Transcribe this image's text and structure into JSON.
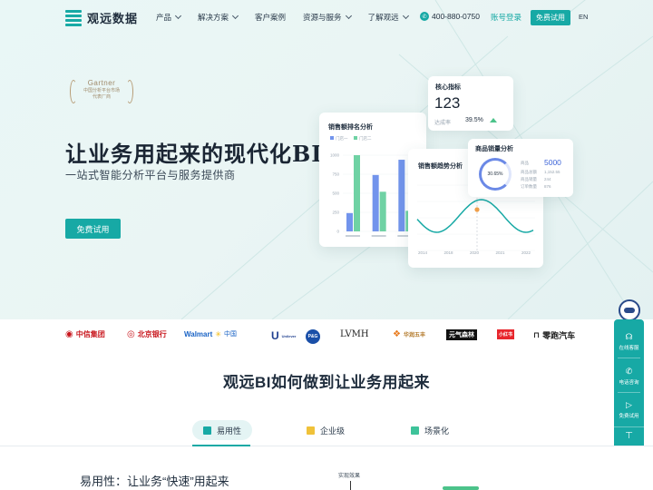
{
  "nav": {
    "brand": "观远数据",
    "menu": [
      {
        "label": "产品",
        "dropdown": true
      },
      {
        "label": "解决方案",
        "dropdown": true
      },
      {
        "label": "客户案例",
        "dropdown": false
      },
      {
        "label": "资源与服务",
        "dropdown": true
      },
      {
        "label": "了解观远",
        "dropdown": true
      }
    ],
    "phone": "400-880-0750",
    "login": "账号登录",
    "trial": "免费试用",
    "lang": "EN"
  },
  "hero": {
    "gartner_title": "Gartner",
    "gartner_line1": "中国分析平台市场",
    "gartner_line2": "代表厂商",
    "title": "让业务用起来的现代化BI",
    "subtitle": "一站式智能分析平台与服务提供商",
    "trial": "免费试用"
  },
  "cards": {
    "kpi": {
      "title": "核心指标",
      "value": "123",
      "label": "达成率",
      "percent": "39.5%"
    },
    "rank": {
      "title": "销售额排名分析",
      "legend": [
        "门店一",
        "门店二"
      ]
    },
    "trend": {
      "title": "销售额趋势分析"
    },
    "product": {
      "title": "商品销量分析",
      "ring_value": "30.65%",
      "rows": [
        {
          "label": "商品",
          "value": "5000"
        },
        {
          "label": "商品总额",
          "value": "1,152.55"
        },
        {
          "label": "商品销量",
          "value": "244"
        },
        {
          "label": "订单数量",
          "value": "876"
        }
      ]
    }
  },
  "chart_data": [
    {
      "type": "bar",
      "title": "销售额排名分析",
      "categories": [
        "",
        "",
        ""
      ],
      "series": [
        {
          "name": "门店一",
          "values": [
            240,
            740,
            940
          ]
        },
        {
          "name": "门店二",
          "values": [
            1000,
            520,
            270
          ]
        }
      ],
      "yticks": [
        "1000",
        "750",
        "500",
        "250",
        "0"
      ],
      "ylim": [
        0,
        1000
      ],
      "colors": [
        "#7294ec",
        "#6fd2a4"
      ]
    },
    {
      "type": "line",
      "title": "销售额趋势分析",
      "x": [
        "2014",
        "2018",
        "2020",
        "2021",
        "2022"
      ],
      "colors": [
        "#17a9a5",
        "#f0a04b"
      ]
    }
  ],
  "logos": [
    "中信集团",
    "北京银行",
    "Walmart",
    "中国",
    "Unilever",
    "P&G",
    "LVMH",
    "华润五丰",
    "元气森林",
    "小红书",
    "零跑汽车"
  ],
  "sidebar": {
    "items": [
      {
        "icon": "headset-icon",
        "label": "在线客服"
      },
      {
        "icon": "phone-icon",
        "label": "电话咨询"
      },
      {
        "icon": "play-icon",
        "label": "免费试用"
      }
    ]
  },
  "section": {
    "title": "观远BI如何做到让业务用起来",
    "tabs": [
      {
        "label": "易用性",
        "color": "#17a9a5",
        "active": true
      },
      {
        "label": "企业级",
        "color": "#f0c23a",
        "active": false
      },
      {
        "label": "场景化",
        "color": "#3ec39a",
        "active": false
      }
    ],
    "sub_title": "易用性：让业务“快速”用起来",
    "axis_label": "实现效果"
  }
}
